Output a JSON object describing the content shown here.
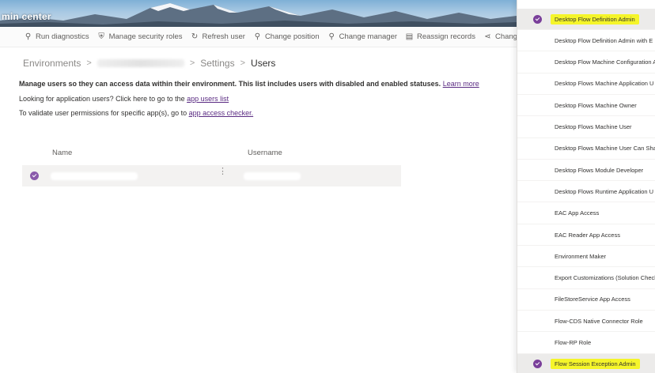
{
  "header": {
    "title": "min center"
  },
  "commands": [
    {
      "label": "Run diagnostics",
      "icon": "run-icon"
    },
    {
      "label": "Manage security roles",
      "icon": "shield-icon"
    },
    {
      "label": "Refresh user",
      "icon": "refresh-icon"
    },
    {
      "label": "Change position",
      "icon": "position-icon"
    },
    {
      "label": "Change manager",
      "icon": "manager-icon"
    },
    {
      "label": "Reassign records",
      "icon": "reassign-icon"
    },
    {
      "label": "Change business",
      "icon": "hierarchy-icon"
    }
  ],
  "breadcrumb": {
    "environments": "Environments",
    "settings": "Settings",
    "users": "Users",
    "separator": ">"
  },
  "description": {
    "line1": "Manage users so they can access data within their environment. This list includes users with disabled and enabled statuses.",
    "line1_link": "Learn more",
    "line2": "Looking for application users? Click here to go to the",
    "line2_link": "app users list",
    "line3": "To validate user permissions for specific app(s), go to",
    "line3_link": "app access checker."
  },
  "table": {
    "columns": [
      "Name",
      "Username"
    ]
  },
  "roles": [
    {
      "label": "Desktop Flow Definition Admin",
      "selected": true,
      "highlight": true
    },
    {
      "label": "Desktop Flow Definition Admin with E",
      "selected": false,
      "highlight": false
    },
    {
      "label": "Desktop Flow Machine Configuration A",
      "selected": false,
      "highlight": false
    },
    {
      "label": "Desktop Flows Machine Application U",
      "selected": false,
      "highlight": false
    },
    {
      "label": "Desktop Flows Machine Owner",
      "selected": false,
      "highlight": false
    },
    {
      "label": "Desktop Flows Machine User",
      "selected": false,
      "highlight": false
    },
    {
      "label": "Desktop Flows Machine User Can Shar",
      "selected": false,
      "highlight": false
    },
    {
      "label": "Desktop Flows Module Developer",
      "selected": false,
      "highlight": false
    },
    {
      "label": "Desktop Flows Runtime Application U",
      "selected": false,
      "highlight": false
    },
    {
      "label": "EAC App Access",
      "selected": false,
      "highlight": false
    },
    {
      "label": "EAC Reader App Access",
      "selected": false,
      "highlight": false
    },
    {
      "label": "Environment Maker",
      "selected": false,
      "highlight": false
    },
    {
      "label": "Export Customizations (Solution Check",
      "selected": false,
      "highlight": false
    },
    {
      "label": "FileStoreService App Access",
      "selected": false,
      "highlight": false
    },
    {
      "label": "Flow-CDS Native Connector Role",
      "selected": false,
      "highlight": false
    },
    {
      "label": "Flow-RP Role",
      "selected": false,
      "highlight": false
    },
    {
      "label": "Flow Session Exception Admin",
      "selected": true,
      "highlight": true
    }
  ],
  "colors": {
    "accent": "#7a3f9a",
    "highlight": "#f5f52a",
    "link": "#5b2c83"
  }
}
